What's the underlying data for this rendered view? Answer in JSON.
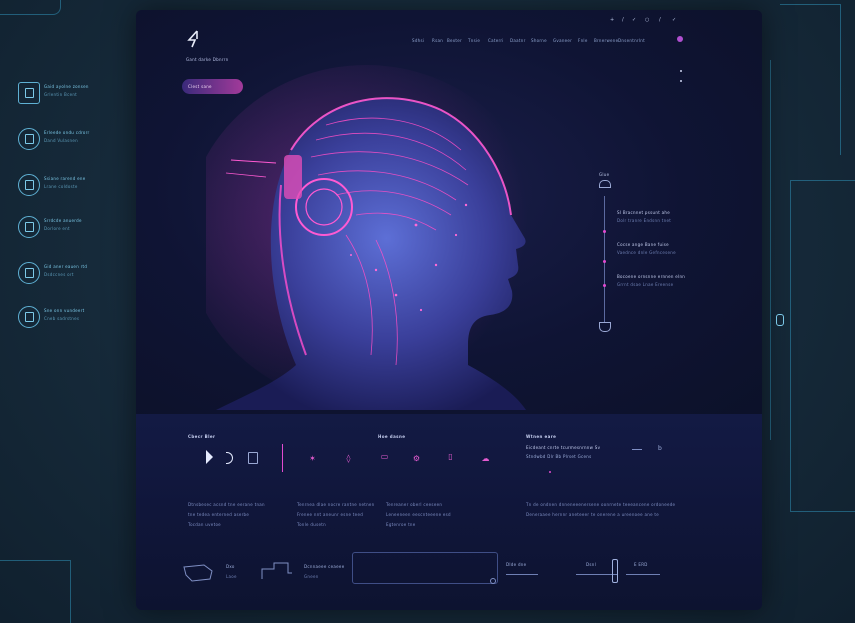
{
  "sidebar_features": [
    {
      "title": "Gaid ayolne zonsen",
      "sub": "Grlentin Bcent"
    },
    {
      "title": "Erleede ondu cdrorr",
      "sub": "Dand Vulasnen"
    },
    {
      "title": "Ssiane rarend ene",
      "sub": "Lrane coldoste"
    },
    {
      "title": "Srrdcde anuerde",
      "sub": "Dorlore ent"
    },
    {
      "title": "Gid aner eauen  rtd",
      "sub": "Dsdccnes ort"
    },
    {
      "title": "Sne onn vundeert",
      "sub": "Cneb sadrstnes"
    }
  ],
  "header": {
    "brand": "Gant darke Dbnrrn",
    "nav": [
      "Sdhsi",
      "Rsan",
      "Bexter",
      "Tnsie",
      "Caterri",
      "Daatnr",
      "Shorne",
      "Gvaneer",
      "Fnle",
      "Brnerwene",
      "Dnsentnrlnt"
    ],
    "cta": "Clest sane",
    "top_icons": [
      "+",
      "/",
      "✓",
      "○",
      "/",
      "✓"
    ]
  },
  "timeline": {
    "label": "Glue",
    "items": [
      {
        "title": "Sl  Bracnnet pssunt ahe",
        "sub": "Dolr tranre Endsnn tnet"
      },
      {
        "title": "Cocse ange Bane fuise",
        "sub": "Vaednce dnle Gefncesene"
      },
      {
        "title": "Bocoene ornsnne ernnen elnn",
        "sub": "Grrnt dsae Lnae Ereense"
      }
    ]
  },
  "section_left": {
    "title": "Cbecr Bler",
    "desc": [
      "Dtnsbesec acsnd tne eerane  tnan",
      "tne tedea enterned  aserbe",
      "Tocdan uvetoe"
    ]
  },
  "section_mid": {
    "title": "Hoe dasne",
    "desc": [
      "Tenrnea  dlae nocre rantne netnen",
      "Frenee nnt aneunr esne teed",
      "Tonle dusetn"
    ]
  },
  "section_mid2": {
    "desc": [
      "Tenreaner oberl ceeseen",
      "Leneeneen eescnteeene esd",
      "Egtenroe tne"
    ]
  },
  "section_right": {
    "title": "Wtnen eare",
    "sub1": "Eicdeant cnrte tcurmesnrnnw  Sv",
    "sub2": "Stndwbd Dlr  Bb  Plrset Gcens",
    "desc": [
      "Tn  de ondnen dnneneeenersene  oonrnete  teeeancene ordoneede",
      "Deneraaee  hernnr  aneteeer te onerene  a  ureenoee  ane te"
    ]
  },
  "footer": {
    "items": [
      {
        "label": "Dxo",
        "sub": "Laoe"
      },
      {
        "label": "Dcnnaeee ceaeee",
        "sub": "Gneen"
      },
      {
        "label": "Dlde dne"
      },
      {
        "label": "Dsnl"
      },
      {
        "label": "E ERD"
      }
    ]
  },
  "colors": {
    "accent": "#e14bd0",
    "bg": "#0d1330",
    "frame": "#2f8fb4"
  }
}
